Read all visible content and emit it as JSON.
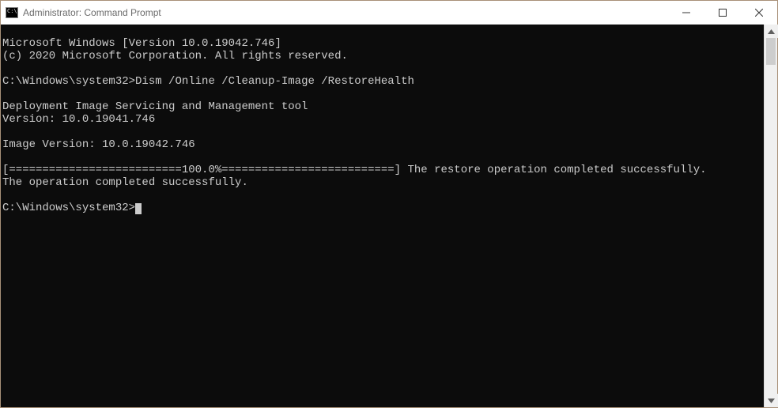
{
  "window": {
    "title": "Administrator: Command Prompt"
  },
  "terminal": {
    "line1": "Microsoft Windows [Version 10.0.19042.746]",
    "line2": "(c) 2020 Microsoft Corporation. All rights reserved.",
    "blank1": "",
    "prompt1_path": "C:\\Windows\\system32>",
    "prompt1_cmd": "Dism /Online /Cleanup-Image /RestoreHealth",
    "blank2": "",
    "tool1": "Deployment Image Servicing and Management tool",
    "tool2": "Version: 10.0.19041.746",
    "blank3": "",
    "imgver": "Image Version: 10.0.19042.746",
    "blank4": "",
    "progress": "[==========================100.0%==========================] The restore operation completed successfully.",
    "done": "The operation completed successfully.",
    "blank5": "",
    "prompt2_path": "C:\\Windows\\system32>"
  }
}
